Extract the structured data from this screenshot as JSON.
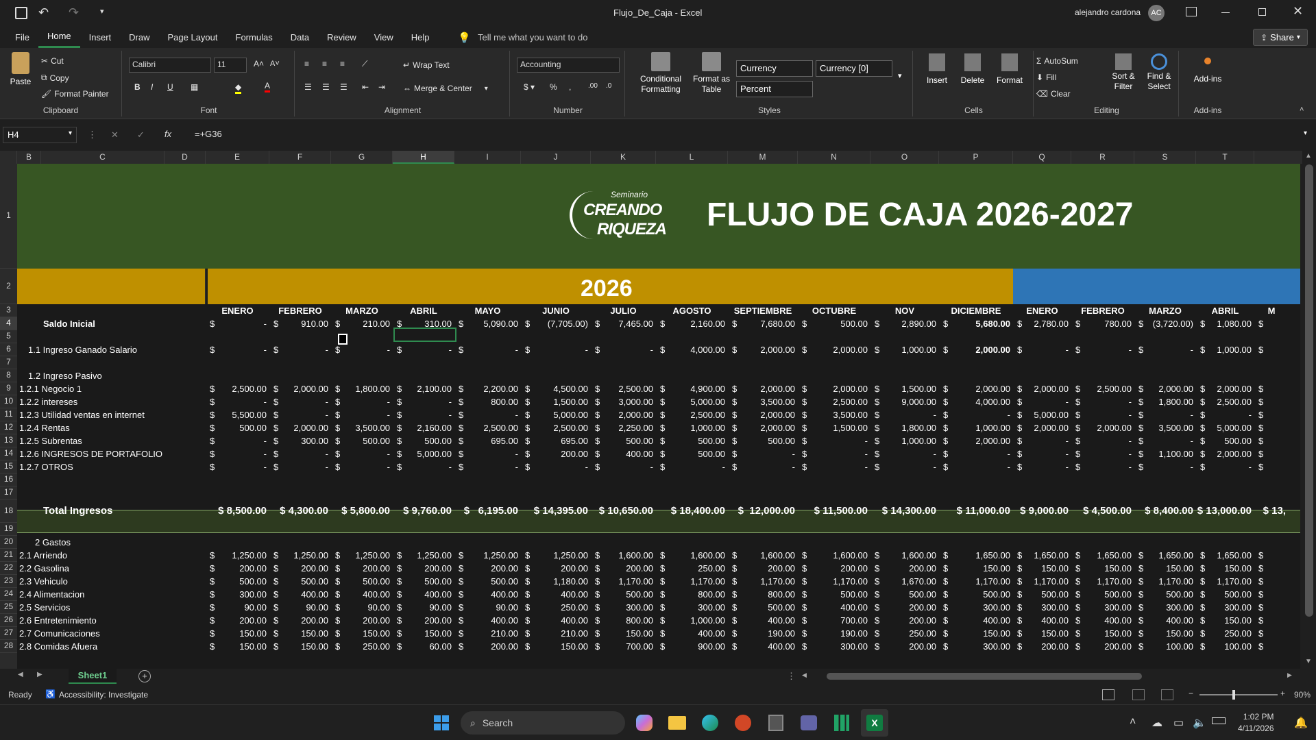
{
  "window": {
    "doc_title": "Flujo_De_Caja  -  Excel",
    "user": "alejandro cardona",
    "user_initials": "AC",
    "share": "Share"
  },
  "menu": [
    "File",
    "Home",
    "Insert",
    "Draw",
    "Page Layout",
    "Formulas",
    "Data",
    "Review",
    "View",
    "Help"
  ],
  "menu_active": "Home",
  "tell_me": "Tell me what you want to do",
  "ribbon": {
    "clipboard": {
      "paste": "Paste",
      "cut": "Cut",
      "copy": "Copy",
      "format_painter": "Format Painter",
      "label": "Clipboard"
    },
    "font": {
      "name": "Calibri",
      "size": "11",
      "label": "Font"
    },
    "alignment": {
      "wrap": "Wrap Text",
      "merge": "Merge & Center",
      "label": "Alignment"
    },
    "number": {
      "format": "Accounting",
      "label": "Number"
    },
    "styles": {
      "conditional": "Conditional Formatting",
      "format_table": "Format as Table",
      "currency": "Currency",
      "currency0": "Currency [0]",
      "percent": "Percent",
      "label": "Styles"
    },
    "cells": {
      "insert": "Insert",
      "delete": "Delete",
      "format": "Format",
      "label": "Cells"
    },
    "editing": {
      "autosum": "AutoSum",
      "fill": "Fill",
      "clear": "Clear",
      "sort": "Sort & Filter",
      "find": "Find & Select",
      "label": "Editing"
    },
    "addins": {
      "addins": "Add-ins",
      "label": "Add-ins"
    }
  },
  "formula_bar": {
    "cell_ref": "H4",
    "formula": "=+G36"
  },
  "columns": [
    "B",
    "C",
    "D",
    "E",
    "F",
    "G",
    "H",
    "I",
    "J",
    "K",
    "L",
    "M",
    "N",
    "O",
    "P",
    "Q",
    "R",
    "S",
    "T"
  ],
  "selected_column": "H",
  "rows": [
    "1",
    "2",
    "3",
    "4",
    "5",
    "6",
    "7",
    "8",
    "9",
    "10",
    "11",
    "12",
    "13",
    "14",
    "15",
    "16",
    "17",
    "18",
    "19",
    "20",
    "21",
    "22",
    "23",
    "24",
    "25",
    "26",
    "27",
    "28"
  ],
  "banner": {
    "logo_top": "Seminario",
    "logo_mid": "CREANDO",
    "logo_bot": "RIQUEZA",
    "title": "FLUJO DE CAJA 2026-2027",
    "year": "2026"
  },
  "months": [
    "ENERO",
    "FEBRERO",
    "MARZO",
    "ABRIL",
    "MAYO",
    "JUNIO",
    "JULIO",
    "AGOSTO",
    "SEPTIEMBRE",
    "OCTUBRE",
    "NOV",
    "DICIEMBRE",
    "ENERO",
    "FEBRERO",
    "MARZO",
    "ABRIL",
    "M"
  ],
  "labels": {
    "r4": "Saldo Inicial",
    "r6": "1.1 Ingreso Ganado Salario",
    "r8": "1.2 Ingreso Pasivo",
    "r9": "1.2.1 Negocio 1",
    "r10": "1.2.2 intereses",
    "r11": "1.2.3 Utilidad ventas en internet",
    "r12": "1.2.4 Rentas",
    "r13": "1.2.5 Subrentas",
    "r14": "1.2.6 INGRESOS DE PORTAFOLIO",
    "r15": "1.2.7 OTROS",
    "r18": "Total Ingresos",
    "r20": "2 Gastos",
    "r21": "2.1 Arriendo",
    "r22": "2.2 Gasolina",
    "r23": "2.3 Vehiculo",
    "r24": "2.4 Alimentacion",
    "r25": "2.5 Servicios",
    "r26": "2.6 Entretenimiento",
    "r27": "2.7 Comunicaciones",
    "r28": "2.8 Comidas Afuera"
  },
  "data": {
    "r4": [
      "-",
      "910.00",
      "210.00",
      "310.00",
      "5,090.00",
      "(7,705.00)",
      "7,465.00",
      "2,160.00",
      "7,680.00",
      "500.00",
      "2,890.00",
      "5,680.00",
      "2,780.00",
      "780.00",
      "(3,720.00)",
      "1,080.00",
      ""
    ],
    "r6": [
      "-",
      "-",
      "-",
      "-",
      "-",
      "-",
      "-",
      "4,000.00",
      "2,000.00",
      "2,000.00",
      "1,000.00",
      "2,000.00",
      "-",
      "-",
      "-",
      "1,000.00",
      ""
    ],
    "r9": [
      "2,500.00",
      "2,000.00",
      "1,800.00",
      "2,100.00",
      "2,200.00",
      "4,500.00",
      "2,500.00",
      "4,900.00",
      "2,000.00",
      "2,000.00",
      "1,500.00",
      "2,000.00",
      "2,000.00",
      "2,500.00",
      "2,000.00",
      "2,000.00",
      ""
    ],
    "r10": [
      "-",
      "-",
      "-",
      "-",
      "800.00",
      "1,500.00",
      "3,000.00",
      "5,000.00",
      "3,500.00",
      "2,500.00",
      "9,000.00",
      "4,000.00",
      "-",
      "-",
      "1,800.00",
      "2,500.00",
      ""
    ],
    "r11": [
      "5,500.00",
      "-",
      "-",
      "-",
      "-",
      "5,000.00",
      "2,000.00",
      "2,500.00",
      "2,000.00",
      "3,500.00",
      "-",
      "-",
      "5,000.00",
      "-",
      "-",
      "-",
      ""
    ],
    "r12": [
      "500.00",
      "2,000.00",
      "3,500.00",
      "2,160.00",
      "2,500.00",
      "2,500.00",
      "2,250.00",
      "1,000.00",
      "2,000.00",
      "1,500.00",
      "1,800.00",
      "1,000.00",
      "2,000.00",
      "2,000.00",
      "3,500.00",
      "5,000.00",
      ""
    ],
    "r13": [
      "-",
      "300.00",
      "500.00",
      "500.00",
      "695.00",
      "695.00",
      "500.00",
      "500.00",
      "500.00",
      "-",
      "1,000.00",
      "2,000.00",
      "-",
      "-",
      "-",
      "500.00",
      ""
    ],
    "r14": [
      "-",
      "-",
      "-",
      "5,000.00",
      "-",
      "200.00",
      "400.00",
      "500.00",
      "-",
      "-",
      "-",
      "-",
      "-",
      "-",
      "1,100.00",
      "2,000.00",
      ""
    ],
    "r15": [
      "-",
      "-",
      "-",
      "-",
      "-",
      "-",
      "-",
      "-",
      "-",
      "-",
      "-",
      "-",
      "-",
      "-",
      "-",
      "-",
      ""
    ],
    "r18": [
      "$ 8,500.00",
      "$ 4,300.00",
      "$ 5,800.00",
      "$ 9,760.00",
      "$   6,195.00",
      "$ 14,395.00",
      "$ 10,650.00",
      "$ 18,400.00",
      "$  12,000.00",
      "$ 11,500.00",
      "$ 14,300.00",
      "$ 11,000.00",
      "$ 9,000.00",
      "$ 4,500.00",
      "$ 8,400.00",
      "$ 13,000.00",
      "$ 13,"
    ],
    "r21": [
      "1,250.00",
      "1,250.00",
      "1,250.00",
      "1,250.00",
      "1,250.00",
      "1,250.00",
      "1,600.00",
      "1,600.00",
      "1,600.00",
      "1,600.00",
      "1,600.00",
      "1,650.00",
      "1,650.00",
      "1,650.00",
      "1,650.00",
      "1,650.00",
      ""
    ],
    "r22": [
      "200.00",
      "200.00",
      "200.00",
      "200.00",
      "200.00",
      "200.00",
      "200.00",
      "250.00",
      "200.00",
      "200.00",
      "200.00",
      "150.00",
      "150.00",
      "150.00",
      "150.00",
      "150.00",
      ""
    ],
    "r23": [
      "500.00",
      "500.00",
      "500.00",
      "500.00",
      "500.00",
      "1,180.00",
      "1,170.00",
      "1,170.00",
      "1,170.00",
      "1,170.00",
      "1,670.00",
      "1,170.00",
      "1,170.00",
      "1,170.00",
      "1,170.00",
      "1,170.00",
      ""
    ],
    "r24": [
      "300.00",
      "400.00",
      "400.00",
      "400.00",
      "400.00",
      "400.00",
      "500.00",
      "800.00",
      "800.00",
      "500.00",
      "500.00",
      "500.00",
      "500.00",
      "500.00",
      "500.00",
      "500.00",
      ""
    ],
    "r25": [
      "90.00",
      "90.00",
      "90.00",
      "90.00",
      "90.00",
      "250.00",
      "300.00",
      "300.00",
      "500.00",
      "400.00",
      "200.00",
      "300.00",
      "300.00",
      "300.00",
      "300.00",
      "300.00",
      ""
    ],
    "r26": [
      "200.00",
      "200.00",
      "200.00",
      "200.00",
      "400.00",
      "400.00",
      "800.00",
      "1,000.00",
      "400.00",
      "700.00",
      "200.00",
      "400.00",
      "400.00",
      "400.00",
      "400.00",
      "150.00",
      ""
    ],
    "r27": [
      "150.00",
      "150.00",
      "150.00",
      "150.00",
      "210.00",
      "210.00",
      "150.00",
      "400.00",
      "190.00",
      "190.00",
      "250.00",
      "150.00",
      "150.00",
      "150.00",
      "150.00",
      "250.00",
      ""
    ],
    "r28": [
      "150.00",
      "150.00",
      "250.00",
      "60.00",
      "200.00",
      "150.00",
      "700.00",
      "900.00",
      "400.00",
      "300.00",
      "200.00",
      "300.00",
      "200.00",
      "200.00",
      "100.00",
      "100.00",
      ""
    ]
  },
  "sheet": {
    "tab": "Sheet1"
  },
  "status": {
    "ready": "Ready",
    "accessibility": "Accessibility: Investigate",
    "zoom": "90%"
  },
  "taskbar": {
    "search": "Search",
    "time": "1:02 PM",
    "date": "4/11/2026"
  },
  "colors": {
    "banner_green": "#375623",
    "gold": "#bf9000",
    "blue": "#2e75b6",
    "total_bg": "#2d3a1f",
    "accent": "#2f8b4f"
  }
}
